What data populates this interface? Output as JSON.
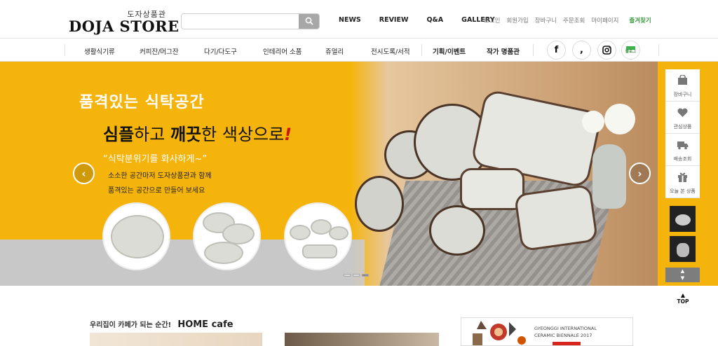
{
  "header": {
    "logo_kr": "도자상품관",
    "logo_en": "DOJA STORE",
    "search_placeholder": "",
    "main_nav": [
      "NEWS",
      "REVIEW",
      "Q&A",
      "GALLERY"
    ],
    "util_nav": [
      "로그인",
      "회원가입",
      "장바구니",
      "주문조회",
      "마이페이지"
    ],
    "favorite_label": "즐겨찾기"
  },
  "categories": {
    "items": [
      "생활식기류",
      "커피잔/머그잔",
      "다기/다도구",
      "인테리어 소품",
      "쥬얼리",
      "전시도록/서적"
    ],
    "special": [
      "기획/이벤트",
      "작가 명품관"
    ],
    "sns": [
      "facebook-icon",
      "kakaostory-icon",
      "instagram-icon",
      "blog-icon"
    ],
    "blog_label": "블로그"
  },
  "hero": {
    "title": "품격있는 식탁공간",
    "subtitle_parts": [
      "심플",
      "하고 ",
      "깨끗",
      "한 색상으로",
      "!"
    ],
    "quote": "“식탁분위기를 화사하게~”",
    "desc_line1": "소소한 공간마저 도자상품관과 함께",
    "desc_line2": "품격있는 공간으로 만들어 보세요",
    "prev_arrow": "‹",
    "next_arrow": "›",
    "slide_count": 3,
    "active_slide": 3
  },
  "quick_menu": {
    "items": [
      {
        "label": "장바구니",
        "icon": "shopping-bag-icon"
      },
      {
        "label": "관심상품",
        "icon": "heart-icon"
      },
      {
        "label": "배송조회",
        "icon": "truck-icon"
      },
      {
        "label": "오늘 본 상품",
        "icon": "gift-icon"
      }
    ],
    "up": "▲",
    "down": "▼"
  },
  "top_button": {
    "arrow": "▲",
    "label": "TOP"
  },
  "home_cafe": {
    "title_kr": "우리집이 카페가 되는 순간!",
    "title_en": "HOME cafe"
  },
  "biennale": {
    "line1": "GYEONGGI INTERNATIONAL",
    "line2": "CERAMIC BIENNALE 2017"
  }
}
